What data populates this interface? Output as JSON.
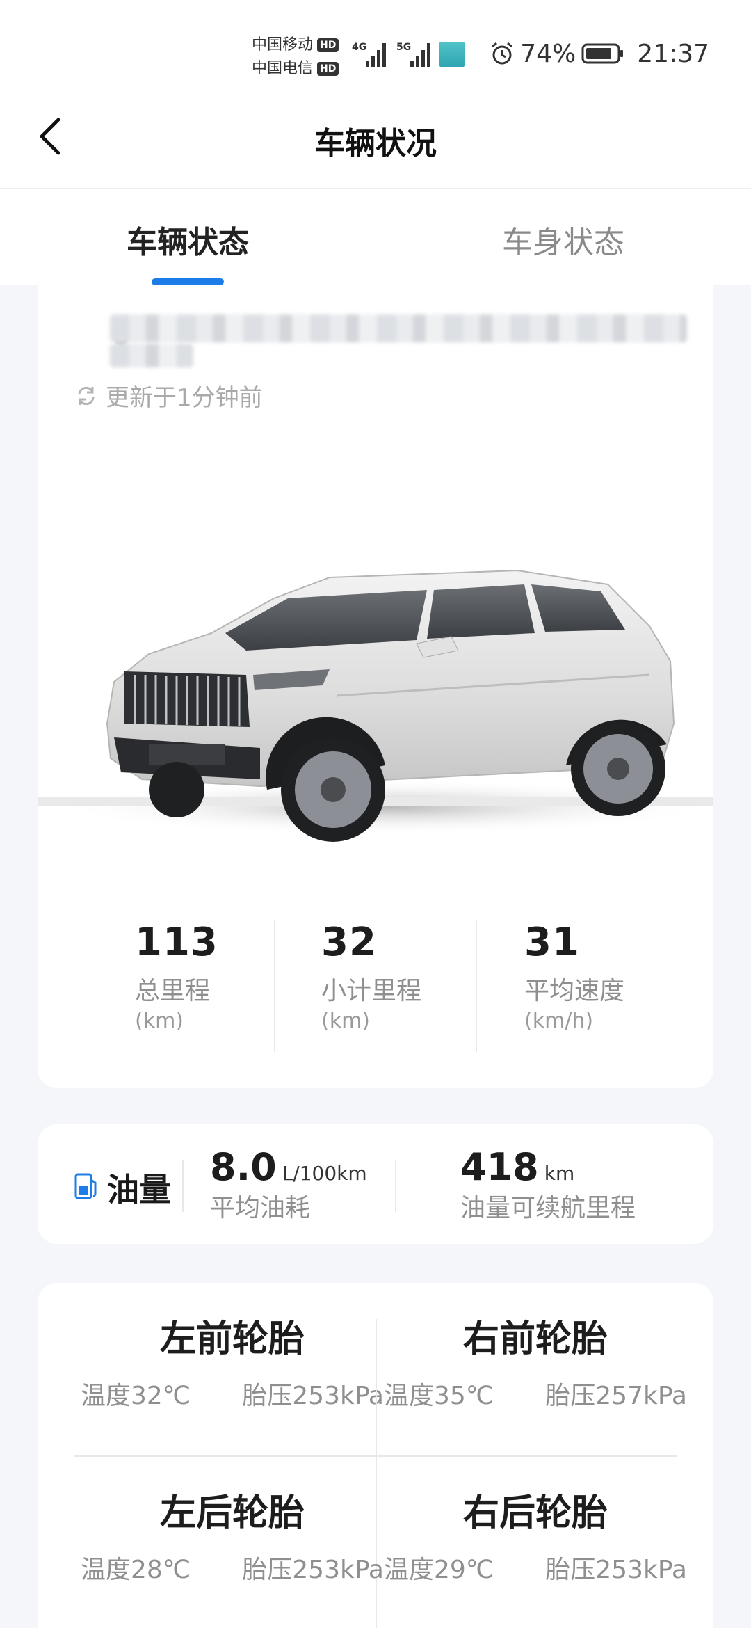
{
  "status_bar": {
    "carrier_1": "中国移动",
    "carrier_2": "中国电信",
    "hd_badge": "HD",
    "net_1": "4G",
    "net_2": "5G",
    "battery": "74%",
    "time": "21:37"
  },
  "nav": {
    "title": "车辆状况"
  },
  "tabs": [
    {
      "label": "车辆状态",
      "active": true
    },
    {
      "label": "车身状态",
      "active": false
    }
  ],
  "vehicle": {
    "updated": "更新于1分钟前",
    "stats": [
      {
        "value": "113",
        "label": "总里程",
        "unit": "(km)"
      },
      {
        "value": "32",
        "label": "小计里程",
        "unit": "(km)"
      },
      {
        "value": "31",
        "label": "平均速度",
        "unit": "(km/h)"
      }
    ]
  },
  "fuel": {
    "title": "油量",
    "consumption_value": "8.0",
    "consumption_unit": "L/100km",
    "consumption_label": "平均油耗",
    "range_value": "418",
    "range_unit": "km",
    "range_label": "油量可续航里程"
  },
  "tires": [
    {
      "name": "左前轮胎",
      "temp": "温度32℃",
      "pressure": "胎压253kPa"
    },
    {
      "name": "右前轮胎",
      "temp": "温度35℃",
      "pressure": "胎压257kPa"
    },
    {
      "name": "左后轮胎",
      "temp": "温度28℃",
      "pressure": "胎压253kPa"
    },
    {
      "name": "右后轮胎",
      "temp": "温度29℃",
      "pressure": "胎压253kPa"
    }
  ],
  "colors": {
    "accent": "#1c7de8",
    "background": "#f4f6f9",
    "card": "#ffffff"
  },
  "icons": {
    "back": "chevron-left-icon",
    "refresh": "refresh-icon",
    "fuel": "fuel-pump-icon",
    "alarm": "alarm-icon",
    "battery": "battery-icon",
    "location": "location-pin-icon"
  }
}
